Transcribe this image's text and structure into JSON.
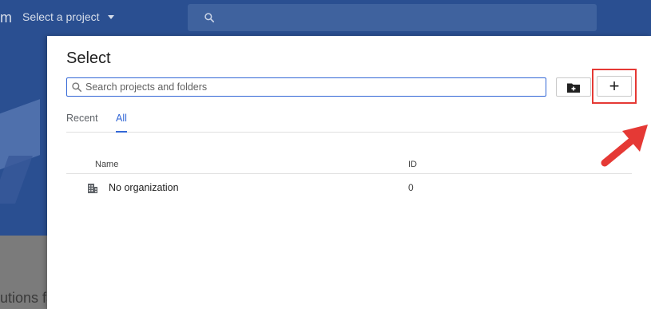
{
  "topbar": {
    "brand_tail": "m",
    "project_selector_label": "Select a project"
  },
  "background": {
    "tail_text": "utions fa"
  },
  "dialog": {
    "title": "Select",
    "search": {
      "placeholder": "Search projects and folders",
      "value": ""
    },
    "new_project_label": "+",
    "tabs": [
      {
        "label": "Recent",
        "active": false
      },
      {
        "label": "All",
        "active": true
      }
    ],
    "table": {
      "columns": [
        "Name",
        "ID"
      ],
      "rows": [
        {
          "name": "No organization",
          "id": "0",
          "icon": "building-icon"
        }
      ]
    }
  },
  "colors": {
    "accent": "#3367d6",
    "header_bg": "#2a4f91",
    "highlight": "#e53935"
  }
}
